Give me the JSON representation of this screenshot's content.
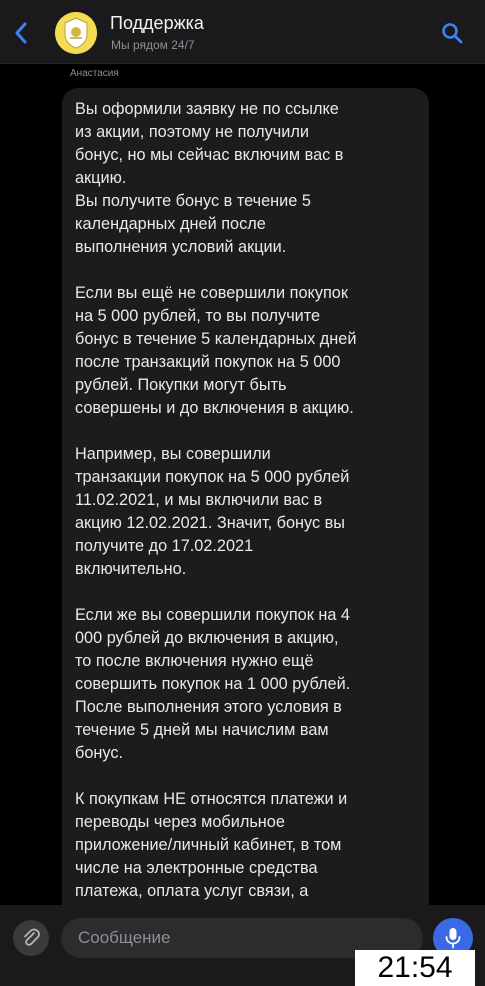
{
  "header": {
    "title": "Поддержка",
    "subtitle": "Мы рядом 24/7",
    "back_icon": "chevron-left-icon",
    "search_icon": "search-icon",
    "accent": "#3b82f6"
  },
  "message": {
    "sender": "Анастасия",
    "paragraphs": [
      "Вы оформили заявку не по ссылке\nиз акции, поэтому не получили\nбонус, но мы сейчас включим вас в\nакцию.\nВы получите бонус в течение 5\nкалендарных дней после\nвыполнения условий акции.",
      "Если вы ещё не совершили покупок\nна 5 000 рублей, то вы получите\nбонус в течение 5 календарных дней\nпосле транзакций покупок на 5 000\nрублей. Покупки могут быть\nсовершены и до включения в акцию.",
      "Например, вы совершили\nтранзакции покупок на 5 000 рублей\n11.02.2021, и мы включили вас в\nакцию 12.02.2021. Значит, бонус вы\nполучите до 17.02.2021\nвключительно.",
      "Если же вы совершили покупок на 4\n000 рублей до включения в акцию,\nто после включения нужно ещё\nсовершить покупок на 1 000 рублей.\nПосле выполнения этого условия в\nтечение 5 дней мы начислим вам\nбонус.",
      "К покупкам НЕ относятся платежи и\nпереводы через мобильное\nприложение/личный кабинет, в том\nчисле на электронные средства\nплатежа, оплата услуг связи, а"
    ]
  },
  "composer": {
    "placeholder": "Сообщение",
    "attach_icon": "paperclip-icon",
    "mic_icon": "microphone-icon",
    "mic_color": "#3b69e6"
  },
  "overlay": {
    "time": "21:54"
  }
}
